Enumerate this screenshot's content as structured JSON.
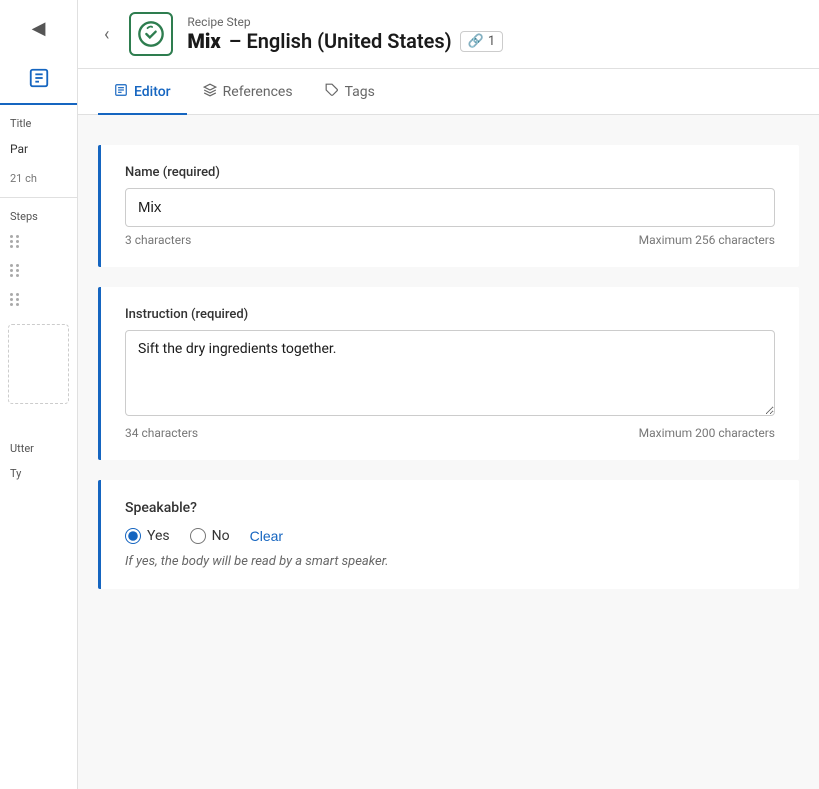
{
  "header": {
    "back_icon": "◀",
    "subtitle": "Recipe Step",
    "title_bold": "Mix",
    "title_rest": " – English (United States)",
    "link_icon": "🔗",
    "link_count": "1"
  },
  "tabs": [
    {
      "id": "editor",
      "label": "Editor",
      "active": true
    },
    {
      "id": "references",
      "label": "References",
      "active": false
    },
    {
      "id": "tags",
      "label": "Tags",
      "active": false
    }
  ],
  "form": {
    "name_label": "Name (required)",
    "name_value": "Mix",
    "name_char_count": "3 characters",
    "name_char_max": "Maximum 256 characters",
    "instruction_label": "Instruction (required)",
    "instruction_value": "Sift the dry ingredients together.",
    "instruction_char_count": "34 characters",
    "instruction_char_max": "Maximum 200 characters",
    "speakable_label": "Speakable?",
    "speakable_yes": "Yes",
    "speakable_no": "No",
    "speakable_clear": "Clear",
    "speakable_hint": "If yes, the body will be read by a smart speaker."
  },
  "left_panel": {
    "title_label": "Title",
    "title_value": "Par",
    "char_count": "21 ch",
    "steps_label": "Steps"
  },
  "icons": {
    "editor_icon": "📄",
    "references_icon": "⬡",
    "tags_icon": "🏷"
  }
}
